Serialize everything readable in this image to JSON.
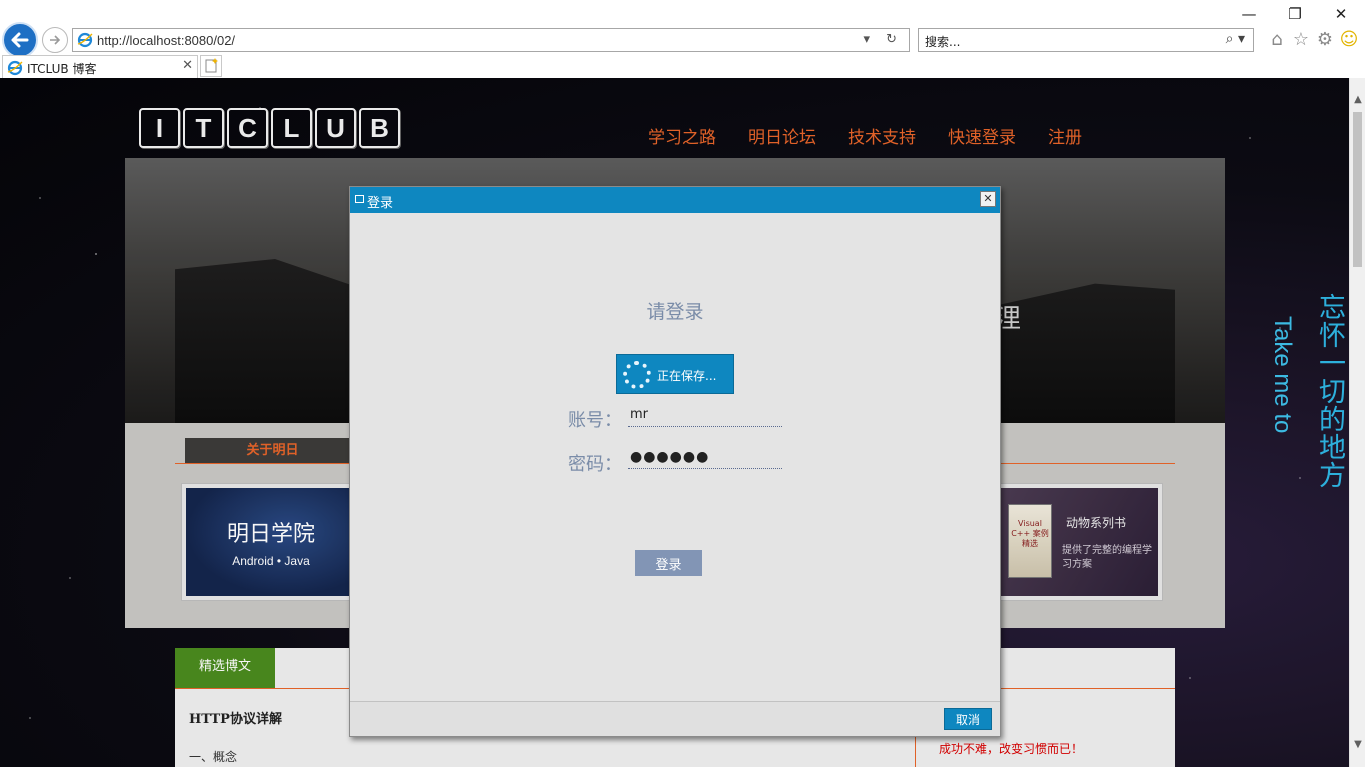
{
  "browser": {
    "url": "http://localhost:8080/02/",
    "search_placeholder": "搜索...",
    "tab_title": "ITCLUB 博客",
    "window_controls": {
      "minimize": "—",
      "maximize": "❐",
      "close": "✕"
    },
    "address_tools": "▾ ↻",
    "search_tools": "⌕ ▾"
  },
  "page": {
    "logo_letters": [
      "I",
      "T",
      "C",
      "L",
      "U",
      "B"
    ],
    "nav": [
      "学习之路",
      "明日论坛",
      "技术支持",
      "快速登录",
      "注册"
    ],
    "banner_glyph": "浬",
    "about_tab": "关于明日",
    "card_left": {
      "title": "明日学院",
      "subtitle": "Android • Java"
    },
    "card_right": {
      "book_text": "Visual C++ 案例精选",
      "title": "动物系列书",
      "desc": "提供了完整的编程学习方案"
    },
    "blog_tab": "精选博文",
    "blog_title": "HTTP协议详解",
    "blog_item": "一、概念",
    "blog_quote": "成功不难，改变习惯而已！",
    "vertical_cn": "忘怀一切的地方",
    "vertical_en": "Take me to"
  },
  "dialog": {
    "title": "登录",
    "heading": "请登录",
    "saving_text": "正在保存...",
    "account_label": "账号：",
    "account_value": "mr",
    "password_label": "密码：",
    "password_mask": "●●●●●●",
    "login_button": "登录",
    "cancel_button": "取消",
    "close_glyph": "✕"
  },
  "colors": {
    "accent_orange": "#e8652a",
    "dialog_blue": "#0e87c0",
    "login_button": "#8295b5",
    "blog_green": "#4b8b1e"
  }
}
